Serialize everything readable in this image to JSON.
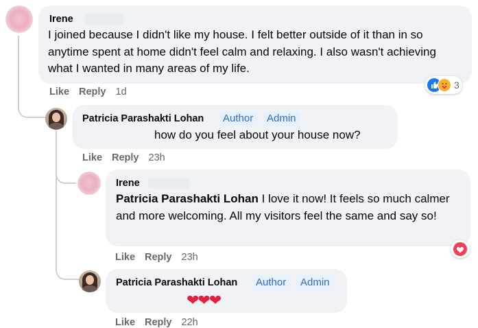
{
  "comments": [
    {
      "author": "Irene",
      "text": "I joined because I didn't like my house. I felt better outside of it than in so anytime spent at home didn't feel calm and relaxing. I also wasn't achieving what I wanted in many areas of my life.",
      "actions": {
        "like": "Like",
        "reply": "Reply",
        "time": "1d"
      },
      "reactions": {
        "icons": [
          "like-icon",
          "care-icon"
        ],
        "count": "3"
      }
    },
    {
      "author": "Patricia Parashakti Lohan",
      "badges": [
        "Author",
        "Admin"
      ],
      "text": "how do you feel about your house now?",
      "actions": {
        "like": "Like",
        "reply": "Reply",
        "time": "23h"
      }
    },
    {
      "author": "Irene",
      "mention": "Patricia Parashakti Lohan",
      "text": " I love it now! It feels so much calmer and more welcoming. All my visitors feel the same and say so!",
      "actions": {
        "like": "Like",
        "reply": "Reply",
        "time": "23h"
      },
      "reactions": {
        "icons": [
          "heart-icon"
        ]
      }
    },
    {
      "author": "Patricia Parashakti Lohan",
      "badges": [
        "Author",
        "Admin"
      ],
      "text": "❤❤❤",
      "actions": {
        "like": "Like",
        "reply": "Reply",
        "time": "22h"
      }
    }
  ],
  "colors": {
    "author_badge": "#2d6ccf",
    "badge_bg": "#e7f0fd",
    "bubble_bg": "#f0f2f5",
    "heart": "#e41e3f",
    "like_blue": "#1877f2"
  }
}
